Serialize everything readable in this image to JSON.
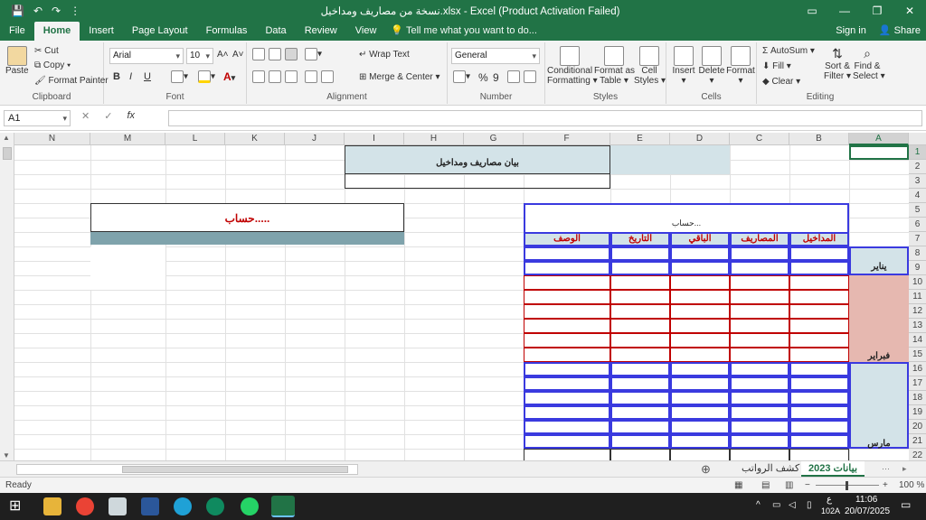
{
  "window": {
    "title": "نسخة من مصاريف ومداخيل.xlsx - Excel (Product Activation Failed)",
    "controls": [
      "▭",
      "—",
      "❐",
      "✕"
    ]
  },
  "qat": [
    "💾",
    "↶",
    "↷",
    "⋮"
  ],
  "tabs": [
    "File",
    "Home",
    "Insert",
    "Page Layout",
    "Formulas",
    "Data",
    "Review",
    "View"
  ],
  "active_tab": "Home",
  "tell_me": "Tell me what you want to do...",
  "sign_in": "Sign in",
  "share": "Share",
  "ribbon": {
    "clipboard": {
      "label": "Clipboard",
      "paste": "Paste",
      "cut": "Cut",
      "copy": "Copy",
      "format_painter": "Format Painter"
    },
    "font": {
      "label": "Font",
      "name": "Arial",
      "size": "10",
      "bold": "B",
      "italic": "I",
      "underline": "U",
      "grow": "A˄",
      "shrink": "A˅"
    },
    "alignment": {
      "label": "Alignment",
      "wrap_text": "Wrap Text",
      "merge_center": "Merge & Center"
    },
    "number": {
      "label": "Number",
      "format": "General",
      "percent": "%",
      "comma": "9"
    },
    "styles": {
      "label": "Styles",
      "conditional": "Conditional",
      "conditional2": "Formatting",
      "format_as": "Format as",
      "format_as2": "Table",
      "cell": "Cell",
      "cell2": "Styles"
    },
    "cells": {
      "label": "Cells",
      "insert": "Insert",
      "delete": "Delete",
      "format": "Format"
    },
    "editing": {
      "label": "Editing",
      "autosum": "AutoSum",
      "fill": "Fill",
      "clear": "Clear",
      "sort": "Sort &",
      "sort2": "Filter",
      "find": "Find &",
      "find2": "Select"
    }
  },
  "formula_bar": {
    "name_box": "A1",
    "cancel": "✕",
    "enter": "✓",
    "fx": "fx",
    "value": ""
  },
  "columns": [
    "N",
    "M",
    "L",
    "K",
    "J",
    "I",
    "H",
    "G",
    "F",
    "E",
    "D",
    "C",
    "B",
    "A"
  ],
  "rows": [
    "1",
    "2",
    "3",
    "4",
    "5",
    "6",
    "7",
    "8",
    "9",
    "10",
    "11",
    "12",
    "13",
    "14",
    "15",
    "16",
    "17",
    "18",
    "19",
    "20",
    "21",
    "22"
  ],
  "sheet": {
    "title_cell": "بيان مصاريف ومداخيل",
    "hesab_big": "حساب.....",
    "hesab_small": "حساب...",
    "headers": [
      "المداخيل",
      "المصاريف",
      "الباقي",
      "التاريخ",
      "الوصف"
    ],
    "months": [
      "يناير",
      "فبراير",
      "مارس"
    ]
  },
  "sheet_tabs": [
    "بيانات 2023",
    "كشف الرواتب"
  ],
  "status": {
    "ready": "Ready",
    "zoom": "100 %"
  },
  "taskbar": {
    "time": "11:06",
    "date": "20/07/2025",
    "lang": "ع",
    "extra": "102A"
  },
  "colors": {
    "excel_green": "#217346",
    "header_fill": "#d3e3e8",
    "feb_fill": "#e6b8b0",
    "mar_fill": "#d3e3e8",
    "hesab_bar": "#7fa3ac",
    "blue_border": "#3a3adf",
    "red_border": "#c00000"
  }
}
